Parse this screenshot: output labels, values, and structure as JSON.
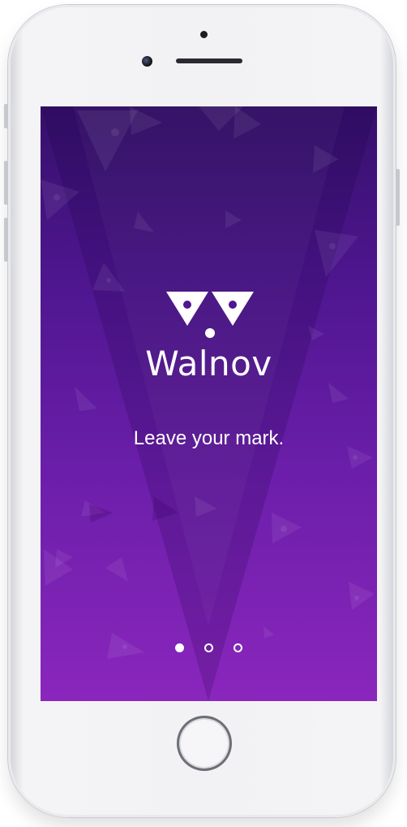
{
  "app": {
    "brand_name": "Walnov",
    "tagline": "Leave your mark."
  },
  "onboarding": {
    "page_count": 3,
    "active_page": 1
  },
  "colors": {
    "background_top": "#35106b",
    "background_bottom": "#8a26bc",
    "text": "#ffffff",
    "device_frame": "#f2f2f4"
  },
  "icons": {
    "logo": "walnov-logo-icon",
    "home": "home-button-icon"
  }
}
